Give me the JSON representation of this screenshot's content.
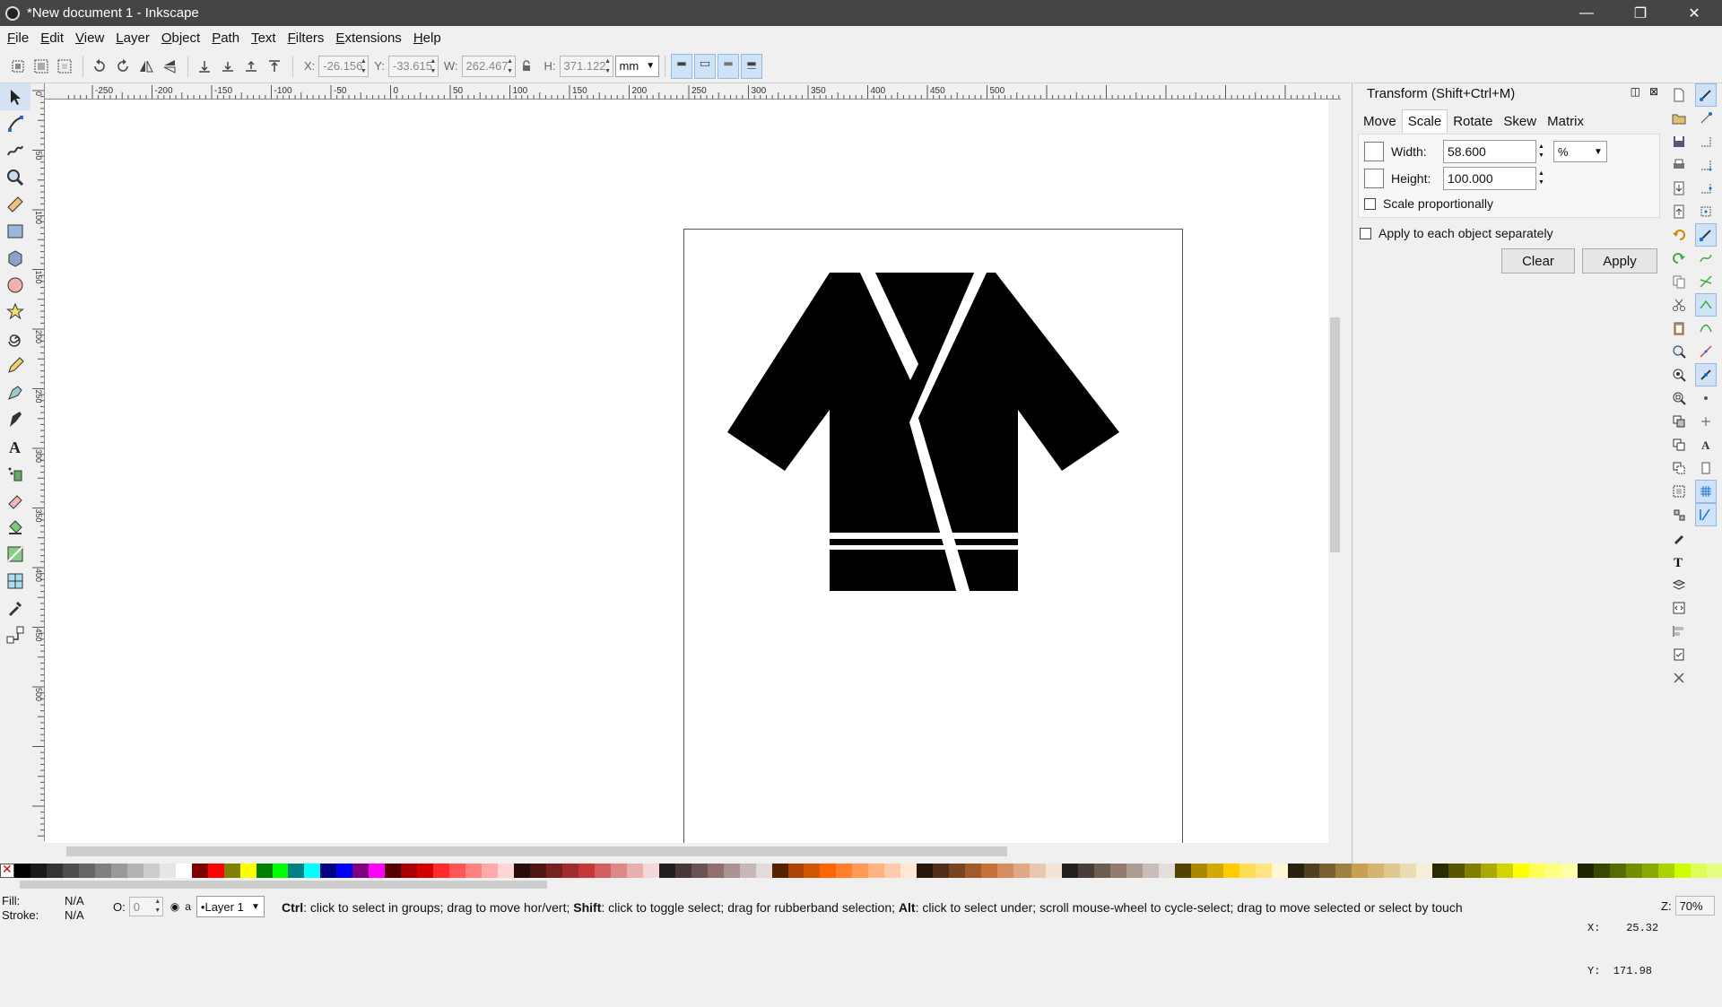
{
  "window": {
    "title": "*New document 1 - Inkscape",
    "min": "—",
    "max": "❐",
    "close": "✕"
  },
  "menu": [
    "File",
    "Edit",
    "View",
    "Layer",
    "Object",
    "Path",
    "Text",
    "Filters",
    "Extensions",
    "Help"
  ],
  "controls": {
    "x_label": "X:",
    "x_value": "-26.156",
    "y_label": "Y:",
    "y_value": "-33.615",
    "w_label": "W:",
    "w_value": "262.467",
    "h_label": "H:",
    "h_value": "371.122",
    "unit": "mm"
  },
  "ruler": {
    "h_labels": [
      "-250",
      "-200",
      "-150",
      "-100",
      "-50",
      "0",
      "50",
      "100",
      "150",
      "200",
      "250",
      "300",
      "350",
      "400",
      "450",
      "500"
    ],
    "v_labels": [
      "0",
      "50",
      "100",
      "150",
      "200",
      "250",
      "300",
      "350",
      "400",
      "450",
      "500"
    ]
  },
  "transform": {
    "title": "Transform (Shift+Ctrl+M)",
    "tabs": [
      "Move",
      "Scale",
      "Rotate",
      "Skew",
      "Matrix"
    ],
    "width_label": "Width:",
    "width_value": "58.600",
    "height_label": "Height:",
    "height_value": "100.000",
    "unit": "%",
    "scale_prop": "Scale proportionally",
    "apply_each": "Apply to each object separately",
    "clear": "Clear",
    "apply": "Apply"
  },
  "status": {
    "fill_label": "Fill:",
    "fill_value": "N/A",
    "stroke_label": "Stroke:",
    "stroke_value": "N/A",
    "opacity_label": "O:",
    "opacity_value": "0",
    "layer": "•Layer 1",
    "message_parts": [
      {
        "b": "Ctrl",
        "t": ": click to select in groups; drag to move hor/vert; "
      },
      {
        "b": "Shift",
        "t": ": click to toggle select; drag for rubberband selection; "
      },
      {
        "b": "Alt",
        "t": ": click to select under; scroll mouse-wheel to cycle-select; drag to move selected or select by touch"
      }
    ],
    "x_coord": "X:    25.32",
    "y_coord": "Y:  171.98",
    "zoom_label": "Z:",
    "zoom": "70%"
  },
  "colors": {
    "accent": "#cfe3f8",
    "titlebar": "#454545"
  },
  "palette": [
    "#000000",
    "#1a1a1a",
    "#333333",
    "#4d4d4d",
    "#666666",
    "#808080",
    "#999999",
    "#b3b3b3",
    "#cccccc",
    "#e6e6e6",
    "#ffffff",
    "#800000",
    "#ff0000",
    "#808000",
    "#ffff00",
    "#008000",
    "#00ff00",
    "#008080",
    "#00ffff",
    "#000080",
    "#0000ff",
    "#800080",
    "#ff00ff",
    "#550000",
    "#aa0000",
    "#d40000",
    "#ff2a2a",
    "#ff5555",
    "#ff8080",
    "#ffaaaa",
    "#ffd5d5",
    "#280b0b",
    "#501616",
    "#782121",
    "#a02c2c",
    "#c83737",
    "#d35f5f",
    "#de8787",
    "#e9afaf",
    "#f4d7d7",
    "#241c1c",
    "#483737",
    "#6c5353",
    "#916f6f",
    "#ac9393",
    "#c8b7b7",
    "#e3dbdb",
    "#552200",
    "#aa4400",
    "#d45500",
    "#ff6600",
    "#ff7f2a",
    "#ff9955",
    "#ffb380",
    "#ffccaa",
    "#ffe6d5",
    "#28170b",
    "#502d16",
    "#784421",
    "#a05a2c",
    "#c87137",
    "#d38d5f",
    "#deaa87",
    "#e9c6af",
    "#f4e3d7",
    "#241f1c",
    "#483e37",
    "#6c5d53",
    "#917c6f",
    "#ac9d93",
    "#c8beb7",
    "#e3dedb",
    "#554400",
    "#aa8800",
    "#d4aa00",
    "#ffcc00",
    "#ffdd55",
    "#ffe680",
    "#fff6d5",
    "#282010",
    "#504020",
    "#786030",
    "#a08040",
    "#c8a050",
    "#d4b46f",
    "#e0c891",
    "#ecdcb4",
    "#f6eed9",
    "#2b2b00",
    "#555500",
    "#808000",
    "#aaaa00",
    "#d4d400",
    "#ffff00",
    "#ffff55",
    "#ffff80",
    "#ffffaa",
    "#1c2400",
    "#384800",
    "#556c00",
    "#718f00",
    "#88aa00",
    "#aad400",
    "#ccff00",
    "#ddff55",
    "#e5ff80"
  ]
}
